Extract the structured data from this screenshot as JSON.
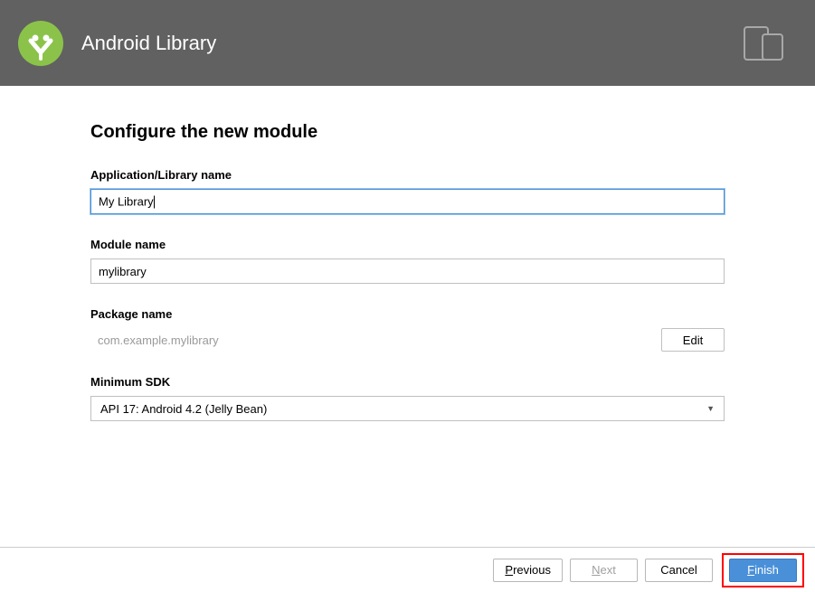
{
  "header": {
    "title": "Android Library"
  },
  "section": {
    "title": "Configure the new module"
  },
  "fields": {
    "library_name": {
      "label": "Application/Library name",
      "value": "My Library"
    },
    "module_name": {
      "label": "Module name",
      "value": "mylibrary"
    },
    "package_name": {
      "label": "Package name",
      "value": "com.example.mylibrary",
      "edit_label": "Edit"
    },
    "min_sdk": {
      "label": "Minimum SDK",
      "value": "API 17: Android 4.2 (Jelly Bean)"
    }
  },
  "buttons": {
    "previous": "Previous",
    "next": "Next",
    "cancel": "Cancel",
    "finish": "Finish"
  }
}
